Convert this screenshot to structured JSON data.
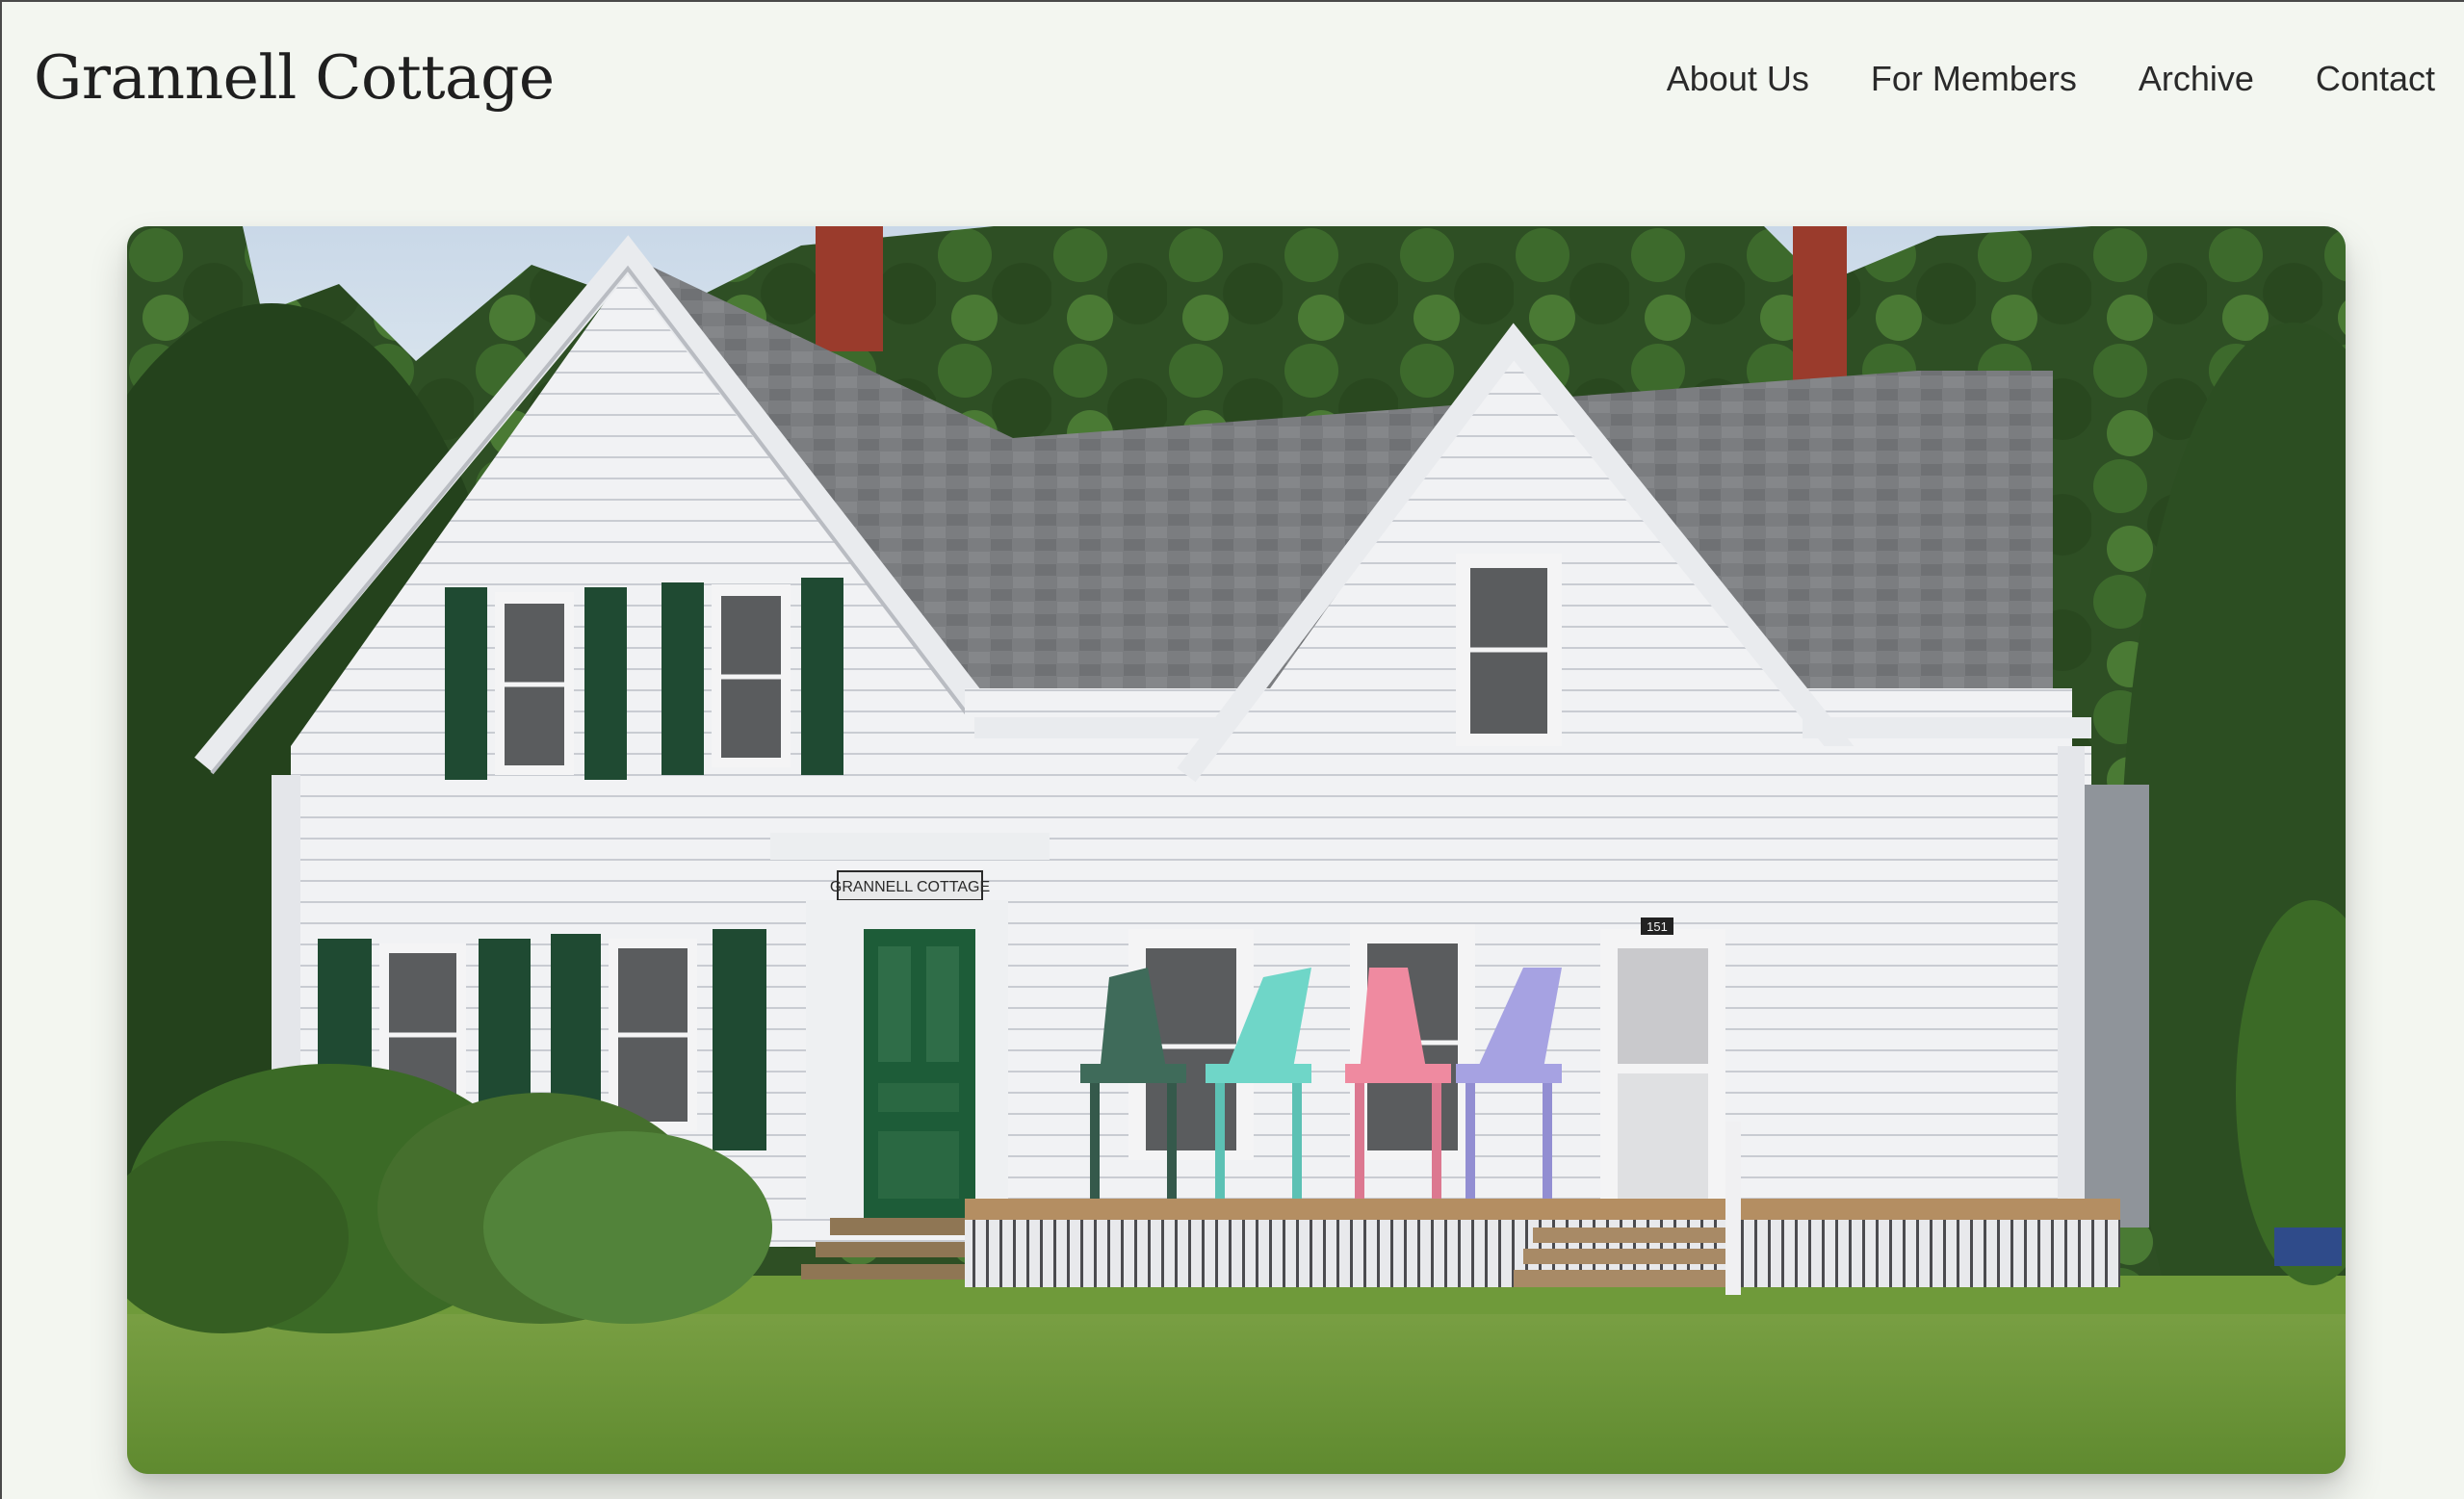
{
  "site": {
    "title": "Grannell Cottage"
  },
  "nav": {
    "items": [
      {
        "label": "About Us"
      },
      {
        "label": "For Members"
      },
      {
        "label": "Archive"
      },
      {
        "label": "Contact"
      }
    ]
  },
  "hero": {
    "alt": "White clapboard cottage with green shutters and four colored Adirondack chairs on the porch",
    "sign_text": "GRANNELL COTTAGE",
    "house_number": "151"
  },
  "colors": {
    "page_background": "#f3f6f0",
    "text": "#2a2a2a",
    "shutter_green": "#1f4a32",
    "chair_colors": [
      "#3f6b5a",
      "#6fd6c8",
      "#ef8aa0",
      "#a6a2e2"
    ]
  }
}
